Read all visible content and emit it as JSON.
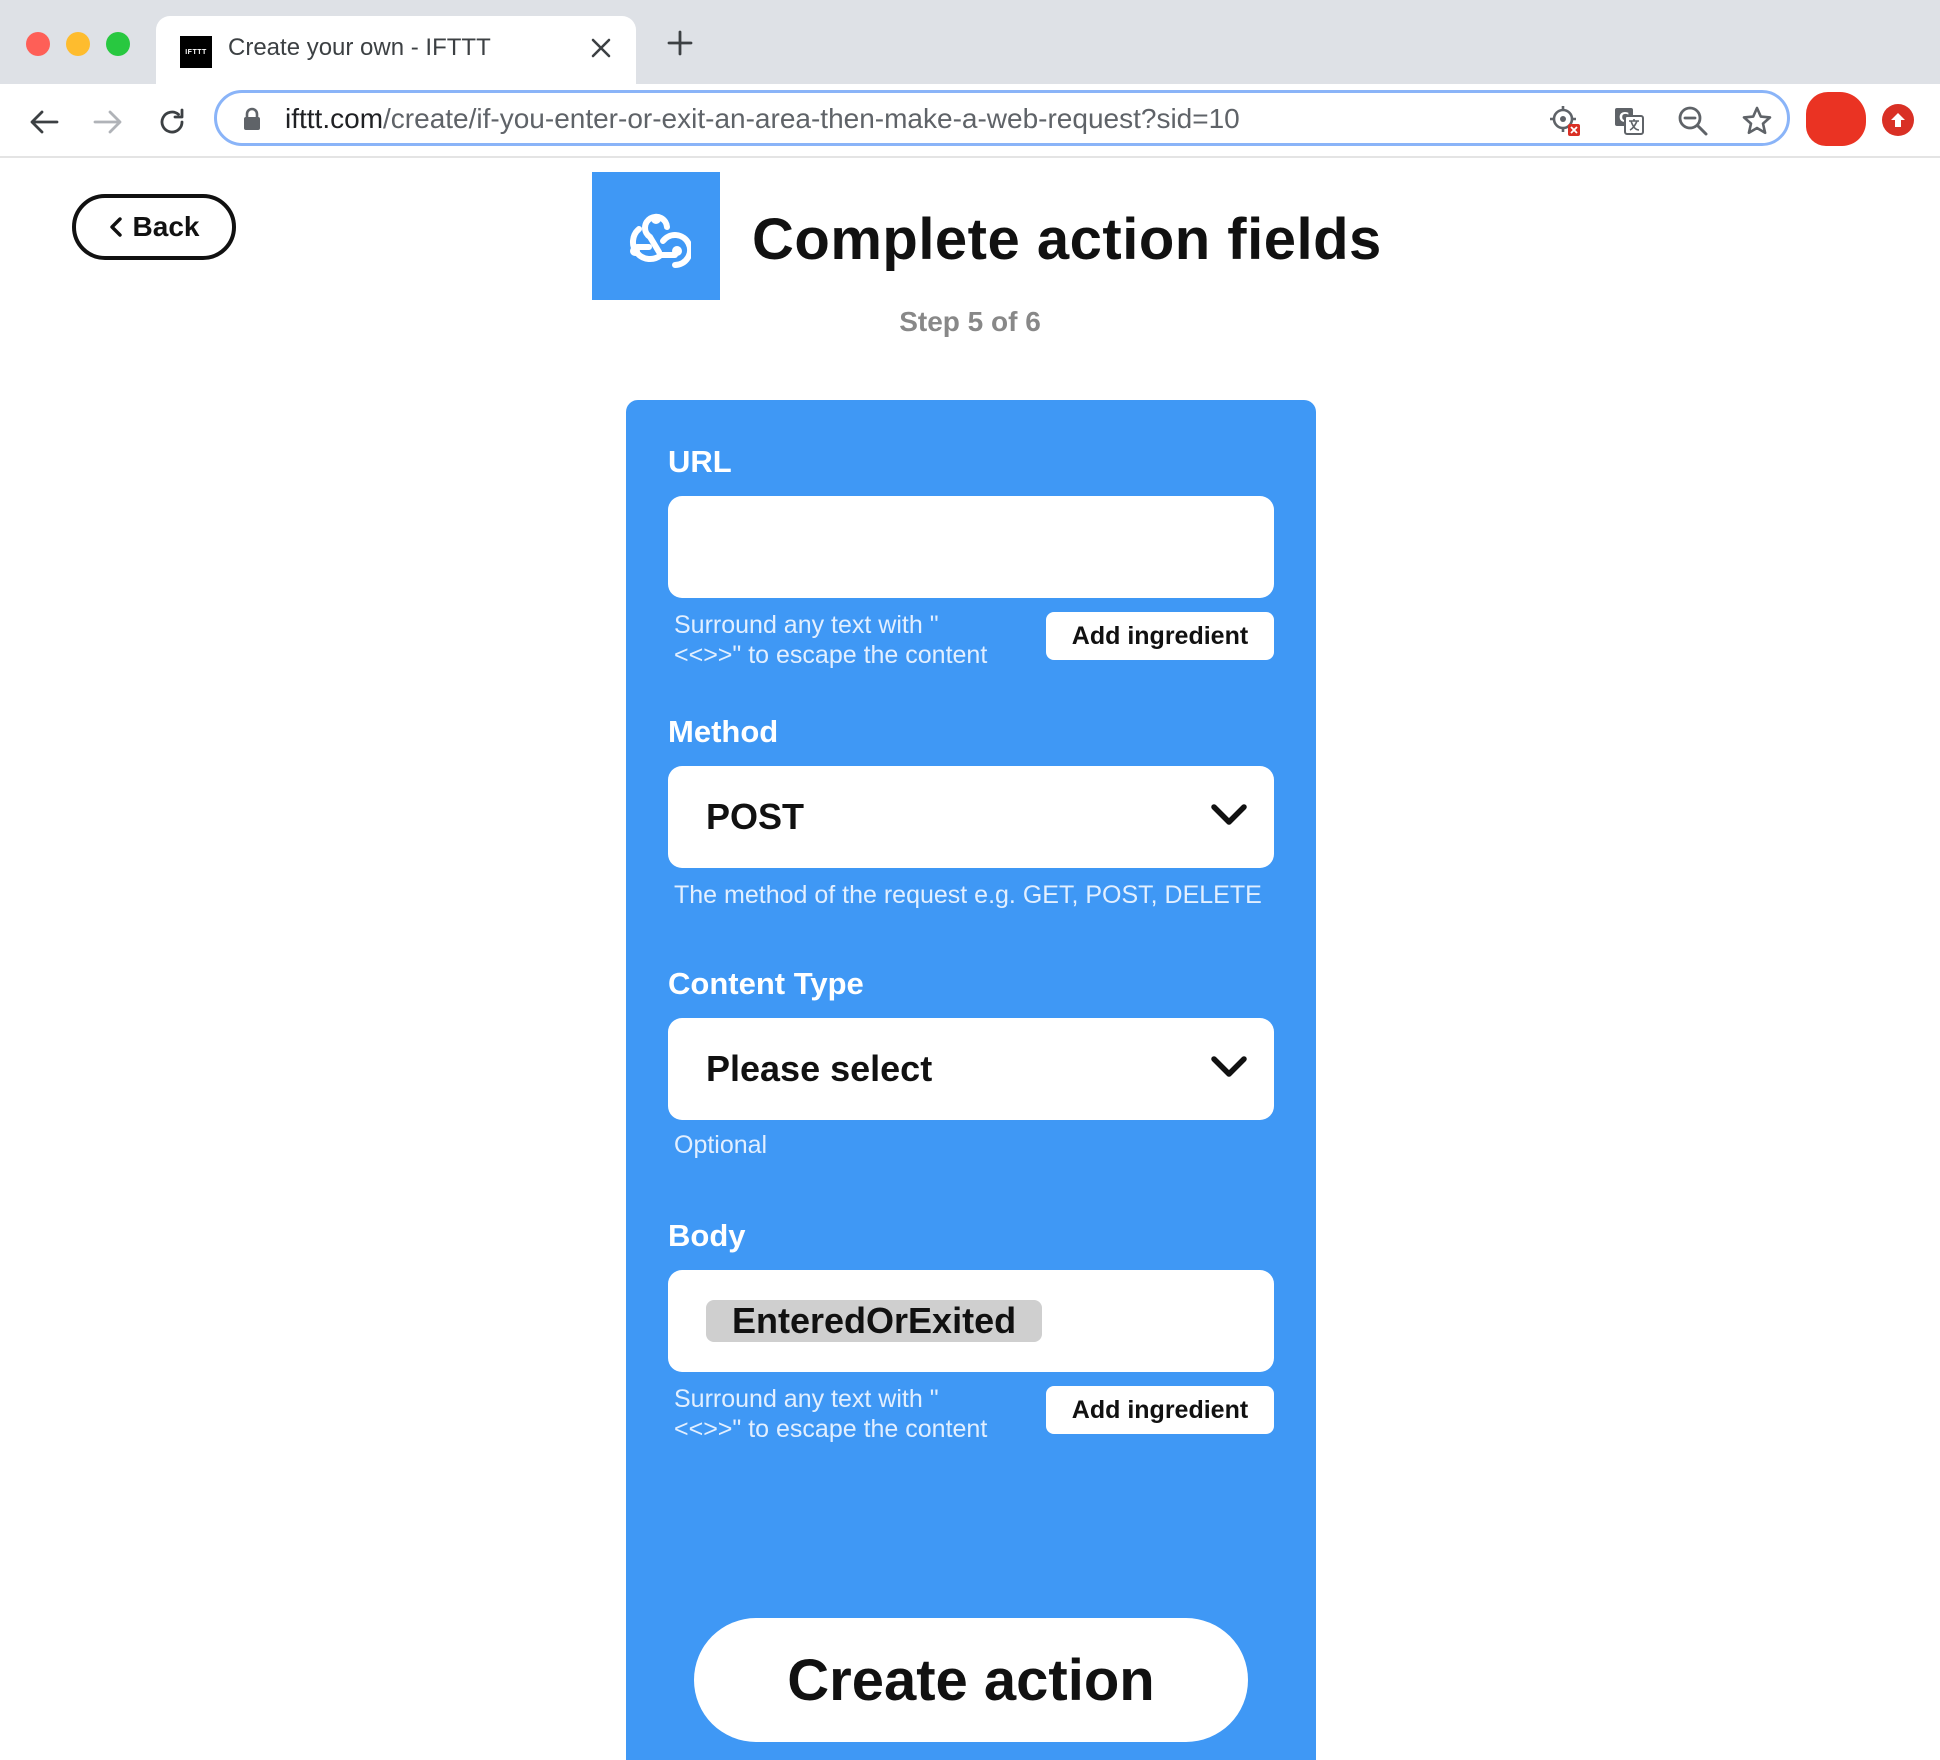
{
  "browser": {
    "tab": {
      "favicon_text": "IFTTT",
      "title": "Create your own - IFTTT"
    },
    "address_bar": {
      "domain": "ifttt.com",
      "path": "/create/if-you-enter-or-exit-an-area-then-make-a-web-request?sid=10"
    }
  },
  "page": {
    "back_label": "Back",
    "service_icon": "webhooks-icon",
    "title": "Complete action fields",
    "step": "Step 5 of 6"
  },
  "form": {
    "url": {
      "label": "URL",
      "value": "",
      "helper_line1": "Surround any text with \"",
      "helper_line2": "<<>>\" to escape the content",
      "add_ingredient": "Add ingredient"
    },
    "method": {
      "label": "Method",
      "selected": "POST",
      "helper": "The method of the request e.g. GET, POST, DELETE"
    },
    "content_type": {
      "label": "Content Type",
      "selected": "Please select",
      "helper": "Optional"
    },
    "body": {
      "label": "Body",
      "ingredient": "EnteredOrExited",
      "helper_line1": "Surround any text with \"",
      "helper_line2": "<<>>\" to escape the content",
      "add_ingredient": "Add ingredient"
    },
    "submit_label": "Create action"
  },
  "colors": {
    "panel_blue": "#3f98f5",
    "text_dark": "#111111",
    "chrome_bg": "#dee1e6"
  }
}
